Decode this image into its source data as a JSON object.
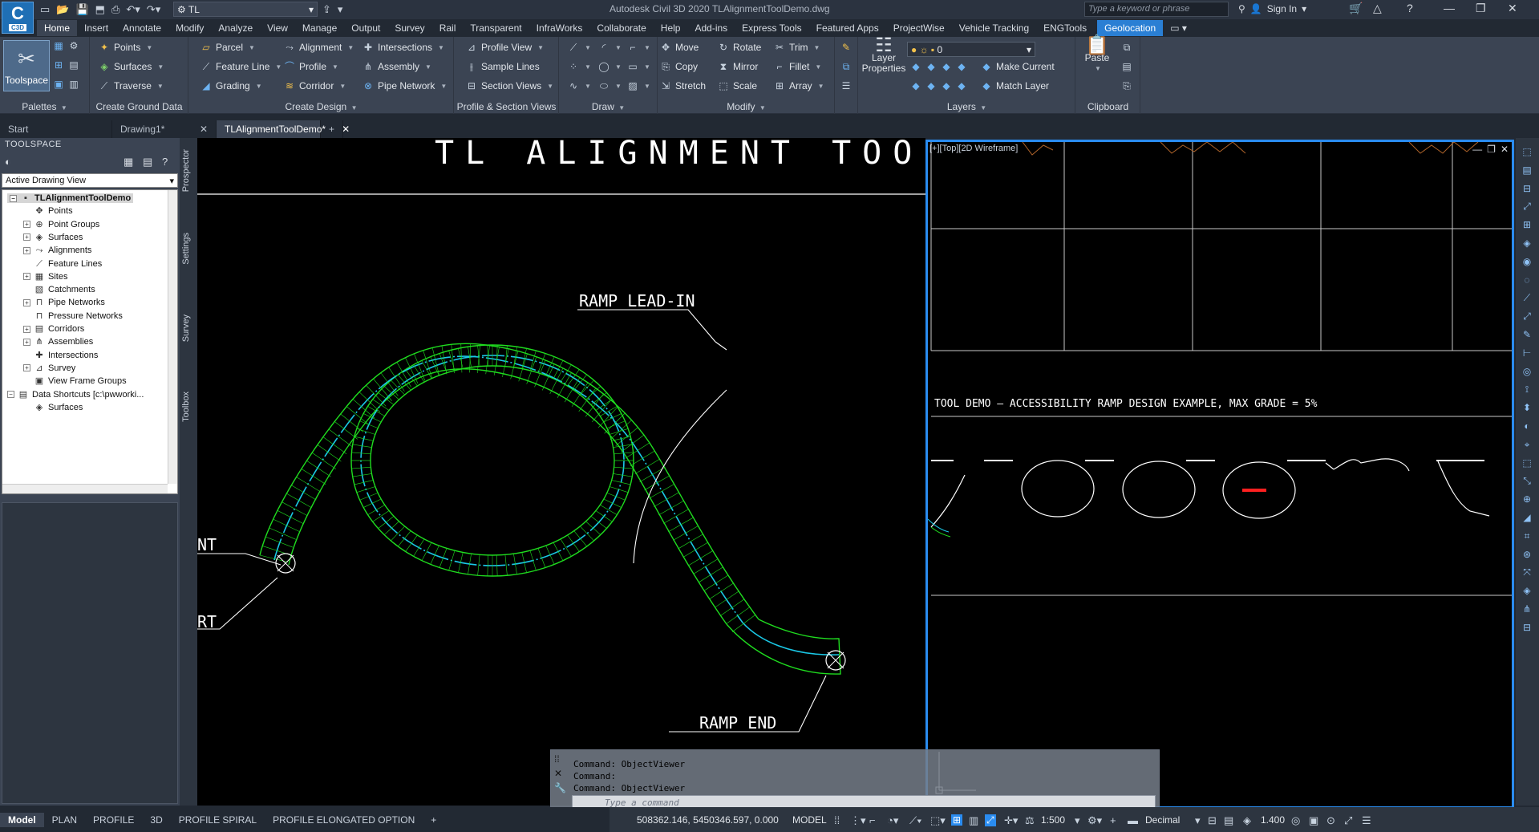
{
  "app": {
    "logo_text": "C",
    "logo_sub": "C3D",
    "title": "Autodesk Civil 3D 2020    TLAlignmentToolDemo.dwg",
    "workspace": "TL",
    "search_placeholder": "Type a keyword or phrase",
    "sign_in": "Sign In"
  },
  "ribbon_tabs": [
    "Home",
    "Insert",
    "Annotate",
    "Modify",
    "Analyze",
    "View",
    "Manage",
    "Output",
    "Survey",
    "Rail",
    "Transparent",
    "InfraWorks",
    "Collaborate",
    "Help",
    "Add-ins",
    "Express Tools",
    "Featured Apps",
    "ProjectWise",
    "Vehicle Tracking",
    "ENGTools"
  ],
  "ribbon_active_tab": "Home",
  "ribbon_highlight_tab": "Geolocation",
  "ribbon": {
    "toolspace": "Toolspace",
    "palettes": "Palettes",
    "ground": {
      "title": "Create Ground Data",
      "points": "Points",
      "surfaces": "Surfaces",
      "traverse": "Traverse"
    },
    "design": {
      "title": "Create Design",
      "parcel": "Parcel",
      "feature_line": "Feature Line",
      "grading": "Grading",
      "alignment": "Alignment",
      "profile": "Profile",
      "corridor": "Corridor",
      "intersections": "Intersections",
      "assembly": "Assembly",
      "pipe_network": "Pipe Network"
    },
    "psv": {
      "title": "Profile & Section Views",
      "profile_view": "Profile View",
      "sample_lines": "Sample Lines",
      "section_views": "Section Views"
    },
    "draw": {
      "title": "Draw"
    },
    "modify": {
      "title": "Modify",
      "move": "Move",
      "copy": "Copy",
      "stretch": "Stretch",
      "rotate": "Rotate",
      "mirror": "Mirror",
      "scale": "Scale",
      "trim": "Trim",
      "fillet": "Fillet",
      "array": "Array"
    },
    "layers": {
      "title": "Layers",
      "layer_properties": "Layer Properties",
      "current_layer": "0",
      "make_current": "Make Current",
      "match_layer": "Match Layer"
    },
    "clipboard": {
      "title": "Clipboard",
      "paste": "Paste"
    }
  },
  "doc_tabs": [
    {
      "label": "Start",
      "active": false,
      "closable": false
    },
    {
      "label": "Drawing1*",
      "active": false,
      "closable": true
    },
    {
      "label": "TLAlignmentToolDemo*",
      "active": true,
      "closable": true
    }
  ],
  "toolspace": {
    "title": "TOOLSPACE",
    "view": "Active Drawing View",
    "tree": [
      {
        "label": "TLAlignmentToolDemo",
        "level": 0,
        "expander": "minus",
        "root": true
      },
      {
        "label": "Points",
        "level": 1,
        "expander": "",
        "icon": "points-icon"
      },
      {
        "label": "Point Groups",
        "level": 1,
        "expander": "plus",
        "icon": "point-groups-icon"
      },
      {
        "label": "Surfaces",
        "level": 1,
        "expander": "plus",
        "icon": "surfaces-icon"
      },
      {
        "label": "Alignments",
        "level": 1,
        "expander": "plus",
        "icon": "alignments-icon"
      },
      {
        "label": "Feature Lines",
        "level": 1,
        "expander": "",
        "icon": "feature-lines-icon"
      },
      {
        "label": "Sites",
        "level": 1,
        "expander": "plus",
        "icon": "sites-icon"
      },
      {
        "label": "Catchments",
        "level": 1,
        "expander": "",
        "icon": "catchments-icon"
      },
      {
        "label": "Pipe Networks",
        "level": 1,
        "expander": "plus",
        "icon": "pipe-networks-icon"
      },
      {
        "label": "Pressure Networks",
        "level": 1,
        "expander": "",
        "icon": "pressure-networks-icon"
      },
      {
        "label": "Corridors",
        "level": 1,
        "expander": "plus",
        "icon": "corridors-icon"
      },
      {
        "label": "Assemblies",
        "level": 1,
        "expander": "plus",
        "icon": "assemblies-icon"
      },
      {
        "label": "Intersections",
        "level": 1,
        "expander": "",
        "icon": "intersections-icon"
      },
      {
        "label": "Survey",
        "level": 1,
        "expander": "plus",
        "icon": "survey-icon"
      },
      {
        "label": "View Frame Groups",
        "level": 1,
        "expander": "",
        "icon": "view-frame-groups-icon"
      },
      {
        "label": "Data Shortcuts [c:\\pwworki...",
        "level": 0,
        "expander": "minus",
        "icon": "data-shortcuts-icon"
      },
      {
        "label": "Surfaces",
        "level": 1,
        "expander": "",
        "icon": "surfaces-icon"
      }
    ],
    "side_tabs": [
      "Prospector",
      "Settings",
      "Survey",
      "Toolbox"
    ]
  },
  "drawing": {
    "title_fragment": "TL  ALIGNMENT  TOOL",
    "label_lead_in": "RAMP  LEAD-IN",
    "label_end": "RAMP  END",
    "label_left_top": "NT",
    "label_left_bottom": "RT",
    "corridor_color": "#1fdc1f",
    "alignment_color": "#1ac8e6"
  },
  "viewport2": {
    "label": "[+][Top][2D Wireframe]",
    "sheet_title": "TOOL  DEMO  –  ACCESSIBILITY  RAMP  DESIGN  EXAMPLE,  MAX  GRADE  =  5%",
    "border_color": "#2a8cf0"
  },
  "command": {
    "history": [
      "Command: ObjectViewer",
      "Command:",
      "Command: ObjectViewer"
    ],
    "placeholder": "Type a command"
  },
  "layout_tabs": [
    "Model",
    "PLAN",
    "PROFILE",
    "3D",
    "PROFILE SPIRAL",
    "PROFILE ELONGATED OPTION"
  ],
  "layout_active": "Model",
  "status": {
    "coords": "508362.146, 5450346.597, 0.000",
    "space": "MODEL",
    "scale": "1:500",
    "units": "Decimal",
    "lineweight": "1.400"
  }
}
